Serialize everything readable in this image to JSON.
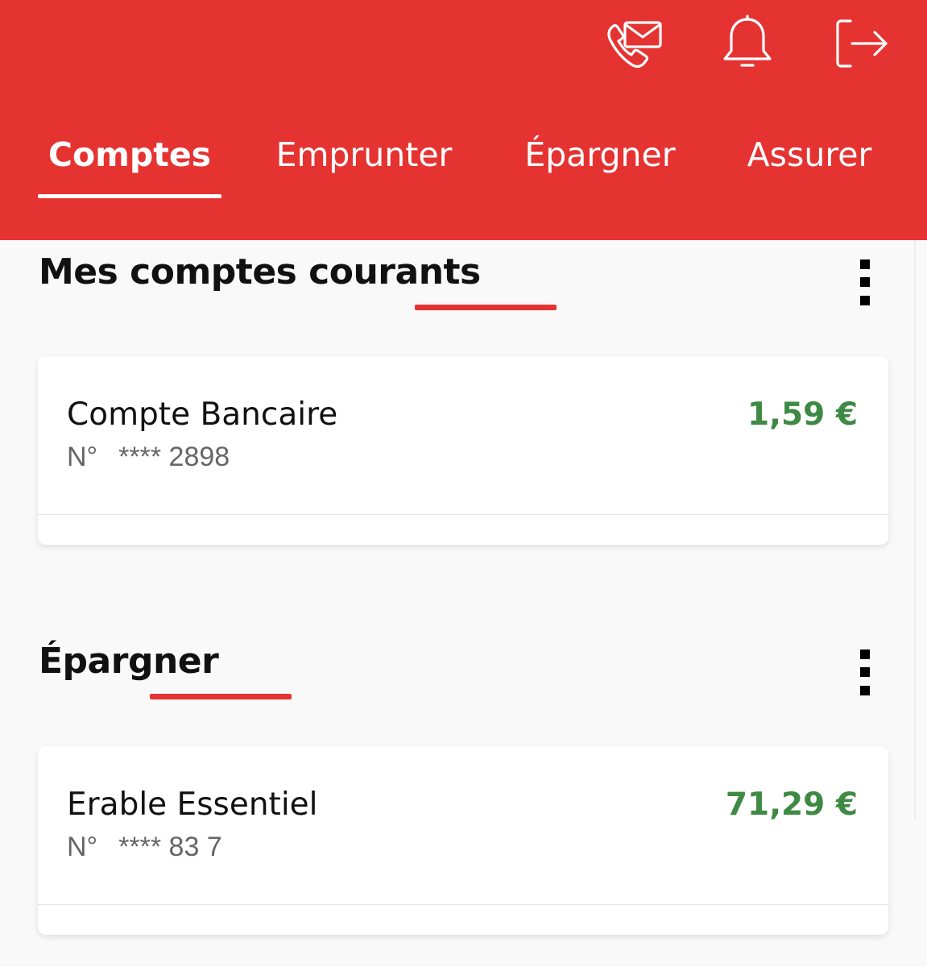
{
  "header": {
    "icons": {
      "contact": "phone-mail-icon",
      "notifications": "bell-icon",
      "logout": "logout-icon"
    },
    "tabs": [
      {
        "label": "Comptes",
        "active": true
      },
      {
        "label": "Emprunter",
        "active": false
      },
      {
        "label": "Épargner",
        "active": false
      },
      {
        "label": "Assurer",
        "active": false
      }
    ]
  },
  "sections": [
    {
      "title": "Mes comptes courants",
      "accounts": [
        {
          "name": "Compte Bancaire",
          "number_prefix": "N°",
          "number": "**** 2898",
          "balance": "1,59 €"
        }
      ]
    },
    {
      "title": "Épargner",
      "accounts": [
        {
          "name": "Erable Essentiel",
          "number_prefix": "N°",
          "number": "**** 83 7",
          "balance": "71,29 €"
        }
      ]
    }
  ],
  "colors": {
    "brand_red": "#e53331",
    "balance_green": "#3e8944",
    "background": "#f9f9f9"
  }
}
